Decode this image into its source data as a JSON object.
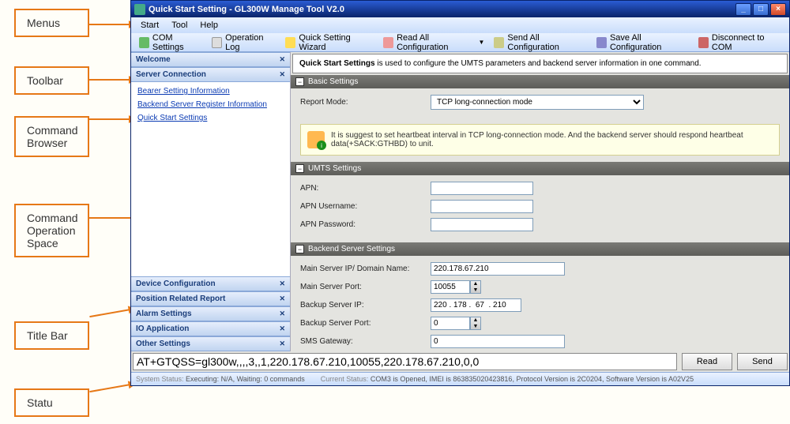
{
  "callouts": {
    "menus": "Menus",
    "toolbar": "Toolbar",
    "command_browser_l1": "Command",
    "command_browser_l2": "Browser",
    "command_op_l1": "Command",
    "command_op_l2": "Operation",
    "command_op_l3": "Space",
    "title_bar": "Title Bar",
    "statu": "Statu"
  },
  "titlebar": {
    "title": "Quick Start Setting - GL300W Manage Tool V2.0"
  },
  "menu": {
    "start": "Start",
    "tool": "Tool",
    "help": "Help"
  },
  "toolbar": {
    "com_settings": "COM Settings",
    "operation_log": "Operation Log",
    "quick_wizard": "Quick Setting Wizard",
    "read_all": "Read All Configuration",
    "send_all": "Send All Configuration",
    "save_all": "Save All Configuration",
    "disconnect": "Disconnect to COM"
  },
  "sidebar": {
    "welcome": "Welcome",
    "server_conn": "Server Connection",
    "links": {
      "bearer": "Bearer Setting Information",
      "backend": "Backend Server Register Information",
      "quick": "Quick Start Settings"
    },
    "device_cfg": "Device Configuration",
    "position": "Position Related Report",
    "alarm": "Alarm Settings",
    "io": "IO Application",
    "other": "Other Settings"
  },
  "content": {
    "desc_bold": "Quick Start Settings",
    "desc_rest": " is used to configure the UMTS parameters and backend server information in one command.",
    "basic_head": "Basic Settings",
    "report_mode_label": "Report Mode:",
    "report_mode_value": "TCP long-connection mode",
    "info_text": "It is suggest to set heartbeat interval in TCP long-connection mode. And the backend server should respond heartbeat data(+SACK:GTHBD) to unit.",
    "umts_head": "UMTS Settings",
    "apn_label": "APN:",
    "apn_user_label": "APN Username:",
    "apn_pass_label": "APN Password:",
    "backend_head": "Backend Server Settings",
    "main_ip_label": "Main Server IP/ Domain Name:",
    "main_ip_value": "220.178.67.210",
    "main_port_label": "Main Server Port:",
    "main_port_value": "10055",
    "backup_ip_label": "Backup Server IP:",
    "backup_ip_value": "220 . 178 .  67  . 210",
    "backup_port_label": "Backup Server Port:",
    "backup_port_value": "0",
    "sms_label": "SMS Gateway:",
    "sms_value": "0"
  },
  "cmdbar": {
    "command": "AT+GTQSS=gl300w,,,,3,,1,220.178.67.210,10055,220.178.67.210,0,0",
    "read": "Read",
    "send": "Send"
  },
  "status": {
    "sys_label": "System Status:",
    "sys_value": "Executing: N/A, Waiting: 0 commands",
    "cur_label": "Current Status:",
    "cur_value": "COM3 is Opened, IMEI is 863835020423816, Protocol Version is 2C0204, Software Version is A02V25"
  }
}
